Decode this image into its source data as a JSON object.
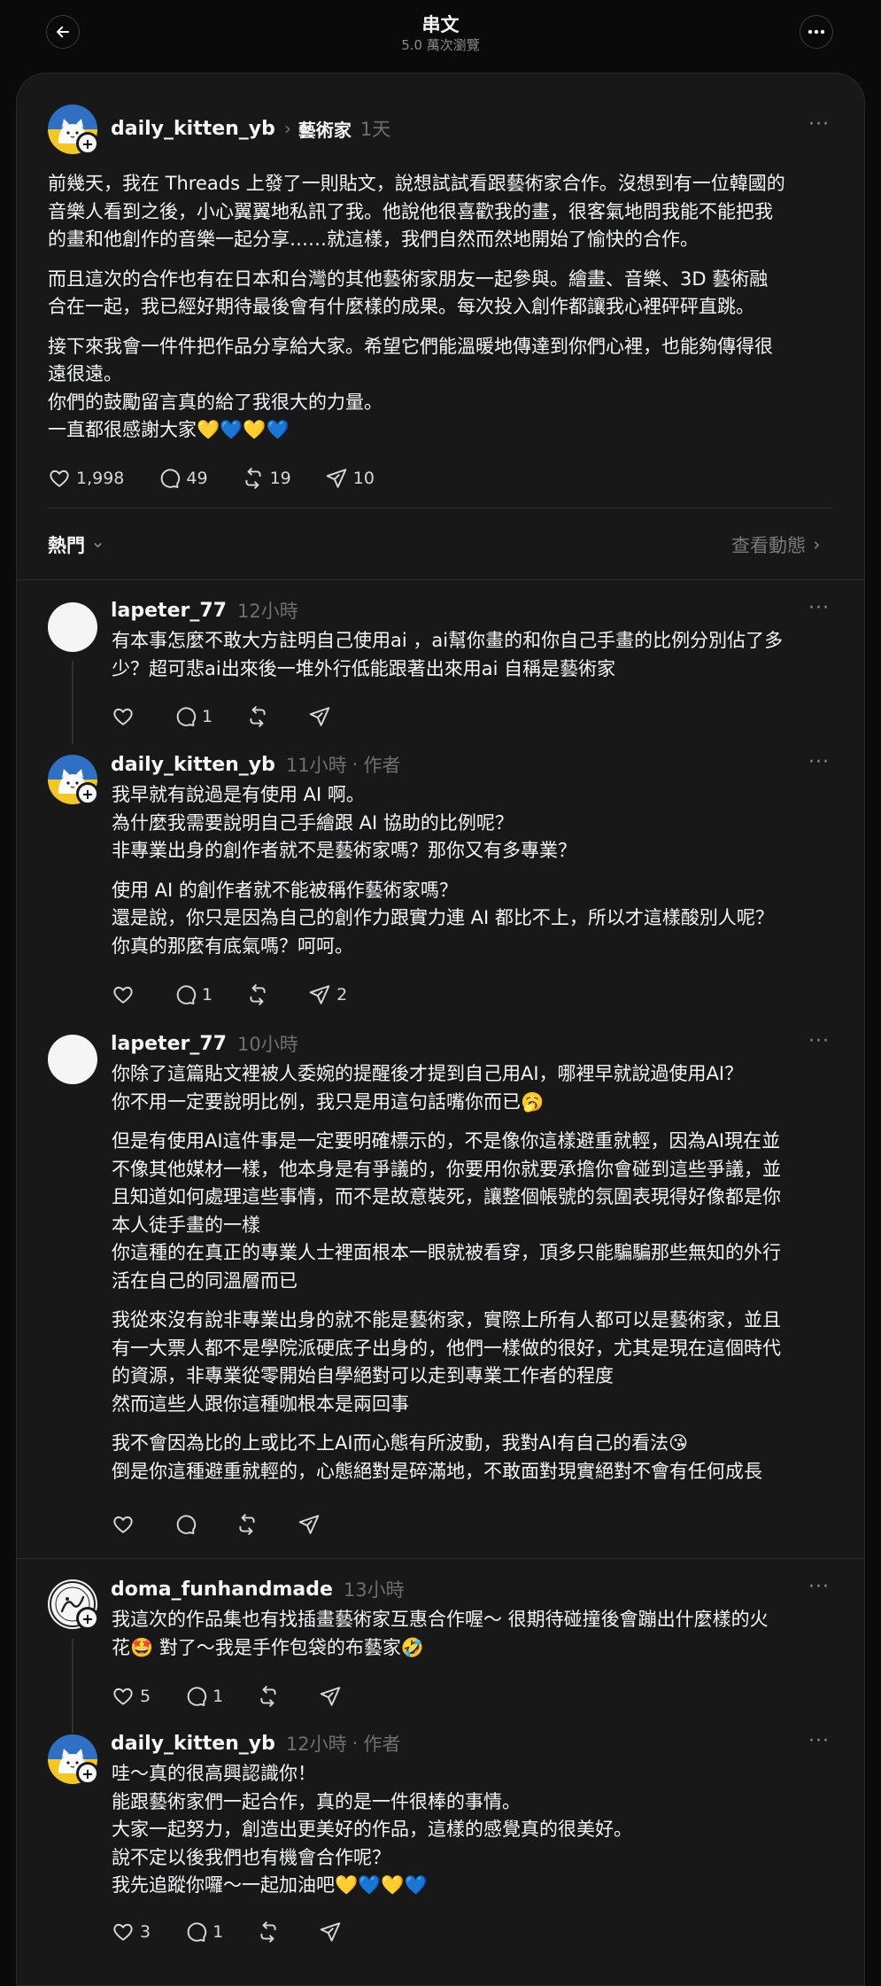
{
  "header": {
    "title": "串文",
    "subtitle": "5.0 萬次瀏覽"
  },
  "post": {
    "username": "daily_kitten_yb",
    "tag": "藝術家",
    "time": "1天",
    "paragraphs": [
      [
        "前幾天，我在 Threads 上發了一則貼文，說想試試看跟藝術家合作。沒想到有一位韓國的",
        "音樂人看到之後，小心翼翼地私訊了我。他說他很喜歡我的畫，很客氣地問我能不能把我",
        "的畫和他創作的音樂一起分享……就這樣，我們自然而然地開始了愉快的合作。"
      ],
      [
        "而且這次的合作也有在日本和台灣的其他藝術家朋友一起參與。繪畫、音樂、3D 藝術融",
        "合在一起，我已經好期待最後會有什麼樣的成果。每次投入創作都讓我心裡砰砰直跳。"
      ],
      [
        "接下來我會一件件把作品分享給大家。希望它們能溫暖地傳達到你們心裡，也能夠傳得很",
        "遠很遠。",
        "你們的鼓勵留言真的給了我很大的力量。",
        "一直都很感謝大家💛💙💛💙"
      ]
    ],
    "likes": "1,998",
    "comments": "49",
    "reposts": "19",
    "shares": "10"
  },
  "sort": {
    "label": "熱門",
    "view_activity": "查看動態"
  },
  "replies": [
    {
      "username": "lapeter_77",
      "time": "12小時",
      "paragraphs": [
        [
          "有本事怎麼不敢大方註明自己使用ai ，ai幫你畫的和你自己手畫的比例分別佔了多",
          "少？超可悲ai出來後一堆外行低能跟著出來用ai 自稱是藝術家"
        ]
      ],
      "likes": "",
      "comments": "1",
      "reposts": "",
      "shares": ""
    },
    {
      "username": "daily_kitten_yb",
      "time": "11小時",
      "author_tag": "作者",
      "paragraphs": [
        [
          "我早就有說過是有使用 AI 啊。",
          "為什麼我需要說明自己手繪跟 AI 協助的比例呢？",
          "非專業出身的創作者就不是藝術家嗎？那你又有多專業？"
        ],
        [
          "使用 AI 的創作者就不能被稱作藝術家嗎？",
          "還是說，你只是因為自己的創作力跟實力連 AI 都比不上，所以才這樣酸別人呢？",
          "你真的那麼有底氣嗎？呵呵。"
        ]
      ],
      "likes": "",
      "comments": "1",
      "reposts": "",
      "shares": "2"
    },
    {
      "username": "lapeter_77",
      "time": "10小時",
      "paragraphs": [
        [
          "你除了這篇貼文裡被人委婉的提醒後才提到自己用AI，哪裡早就說過使用AI？",
          "你不用一定要說明比例，我只是用這句話嘴你而已🥱"
        ],
        [
          "但是有使用AI這件事是一定要明確標示的，不是像你這樣避重就輕，因為AI現在並",
          "不像其他媒材一樣，他本身是有爭議的，你要用你就要承擔你會碰到這些爭議，並",
          "且知道如何處理這些事情，而不是故意裝死，讓整個帳號的氛圍表現得好像都是你",
          "本人徒手畫的一樣",
          "你這種的在真正的專業人士裡面根本一眼就被看穿，頂多只能騙騙那些無知的外行",
          "活在自己的同溫層而已"
        ],
        [
          "我從來沒有說非專業出身的就不能是藝術家，實際上所有人都可以是藝術家，並且",
          "有一大票人都不是學院派硬底子出身的，他們一樣做的很好，尤其是現在這個時代",
          "的資源，非專業從零開始自學絕對可以走到專業工作者的程度",
          "然而這些人跟你這種咖根本是兩回事"
        ],
        [
          "我不會因為比的上或比不上AI而心態有所波動，我對AI有自己的看法😘",
          "倒是你這種避重就輕的，心態絕對是碎滿地，不敢面對現實絕對不會有任何成長"
        ]
      ],
      "likes": "",
      "comments": "",
      "reposts": "",
      "shares": ""
    },
    {
      "username": "doma_funhandmade",
      "time": "13小時",
      "paragraphs": [
        [
          "我這次的作品集也有找插畫藝術家互惠合作喔～ 很期待碰撞後會蹦出什麼樣的火",
          "花🤩 對了～我是手作包袋的布藝家🤣"
        ]
      ],
      "likes": "5",
      "comments": "1",
      "reposts": "",
      "shares": ""
    },
    {
      "username": "daily_kitten_yb",
      "time": "12小時",
      "author_tag": "作者",
      "paragraphs": [
        [
          "哇～真的很高興認識你！",
          "能跟藝術家們一起合作，真的是一件很棒的事情。",
          "大家一起努力，創造出更美好的作品，這樣的感覺真的很美好。",
          "說不定以後我們也有機會合作呢？",
          "我先追蹤你囉～一起加油吧💛💙💛💙"
        ]
      ],
      "likes": "3",
      "comments": "1",
      "reposts": "",
      "shares": ""
    }
  ],
  "icons": {
    "back": "arrow-left-icon",
    "more": "more-icon",
    "like": "heart-icon",
    "comment": "comment-icon",
    "repost": "repost-icon",
    "share": "send-icon"
  },
  "colors": {
    "background": "#0a0a0a",
    "panel": "#181818",
    "text": "#f3f5f7",
    "muted": "#6f6f6f"
  }
}
